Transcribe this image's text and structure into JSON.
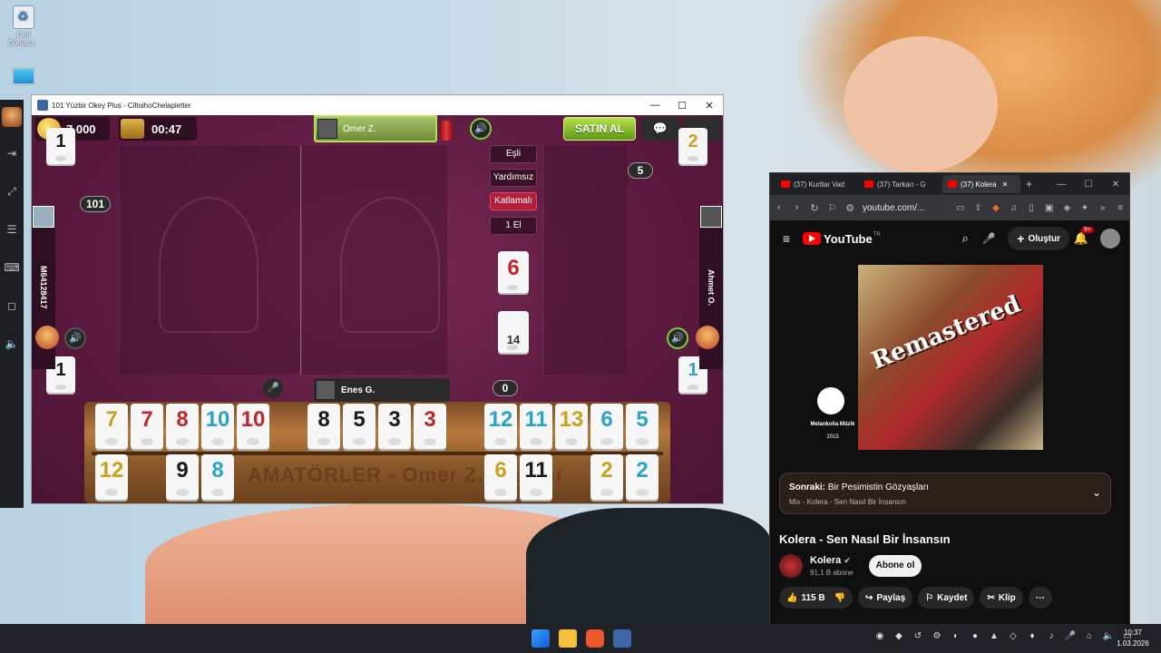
{
  "desktop": {
    "icons": [
      {
        "name": "recycle-bin",
        "label": "Geri Dönüşü..."
      },
      {
        "name": "this-pc",
        "label": ""
      }
    ]
  },
  "game_window": {
    "title": "101 Yüzbir Okey Plus - CiltoihoChelapietter",
    "controls": [
      "—",
      "☐",
      "✕"
    ],
    "coins": "7.000",
    "timer": "00:47",
    "top_player": "Omer Z.",
    "buy_label": "SATIN AL",
    "options": [
      "Eşli",
      "Yardımsız",
      "Katlamalı",
      "1 El"
    ],
    "left_player": "M64128417",
    "right_player": "Ahmet O.",
    "bottom_player": "Enes G.",
    "badge_101": "101",
    "badge_5": "5",
    "badge_0": "0",
    "discards": {
      "top_left": {
        "value": "1",
        "color": "#1a1a1a"
      },
      "top_right": {
        "value": "2",
        "color": "#c9a21c"
      },
      "bottom_left": {
        "value": "1",
        "color": "#1a1a1a"
      },
      "bottom_right": {
        "value": "1",
        "color": "#2aa3c9"
      }
    },
    "center_tile": {
      "value": "6",
      "color": "#c0262c"
    },
    "deck_count": "14",
    "rack_text": "AMATÖRLER - Omer Z. Masası",
    "rack_top": [
      {
        "v": "7",
        "c": "#c9a21c"
      },
      {
        "v": "7",
        "c": "#c0262c"
      },
      {
        "v": "8",
        "c": "#c0262c"
      },
      {
        "v": "10",
        "c": "#2aa3c9"
      },
      {
        "v": "10",
        "c": "#c0262c"
      },
      {
        "v": "8",
        "c": "#1a1a1a"
      },
      {
        "v": "5",
        "c": "#1a1a1a"
      },
      {
        "v": "3",
        "c": "#1a1a1a"
      },
      {
        "v": "3",
        "c": "#c0262c"
      },
      {
        "v": "12",
        "c": "#2aa3c9"
      },
      {
        "v": "11",
        "c": "#2aa3c9"
      },
      {
        "v": "13",
        "c": "#c9a21c"
      },
      {
        "v": "6",
        "c": "#2aa3c9"
      },
      {
        "v": "5",
        "c": "#2aa3c9"
      }
    ],
    "rack_bottom": [
      {
        "v": "12",
        "c": "#c9a21c"
      },
      {
        "v": "9",
        "c": "#1a1a1a"
      },
      {
        "v": "8",
        "c": "#2aa3c9"
      },
      {
        "v": "6",
        "c": "#c9a21c"
      },
      {
        "v": "11",
        "c": "#1a1a1a"
      },
      {
        "v": "2",
        "c": "#c9a21c"
      },
      {
        "v": "2",
        "c": "#2aa3c9"
      }
    ]
  },
  "browser": {
    "tabs": [
      {
        "label": "(37) Kurtlar Vad"
      },
      {
        "label": "(37) Tarkan - G"
      },
      {
        "label": "(37) Kolera"
      }
    ],
    "url": "youtube.com/...",
    "yt_logo": "YouTube",
    "yt_region": "TR",
    "create_label": "Oluştur",
    "notif_count": "9+",
    "album_art_text": "Remastered",
    "album_label": "Melankolia Müzik",
    "album_year": "2015",
    "next": {
      "prefix": "Sonraki:",
      "title": "Bir Pesimistin Gözyaşları",
      "sub": "Mix - Kolera - Sen Nasıl Bir İnsansın"
    },
    "video_title": "Kolera - Sen Nasıl Bir İnsansın",
    "channel": "Kolera",
    "subs": "91,1 B abone",
    "subscribe_label": "Abone ol",
    "likes": "115 B",
    "share_label": "Paylaş",
    "save_label": "Kaydet",
    "clip_label": "Klip"
  },
  "taskbar": {
    "time": "10:37",
    "date": "1.03.2026"
  }
}
